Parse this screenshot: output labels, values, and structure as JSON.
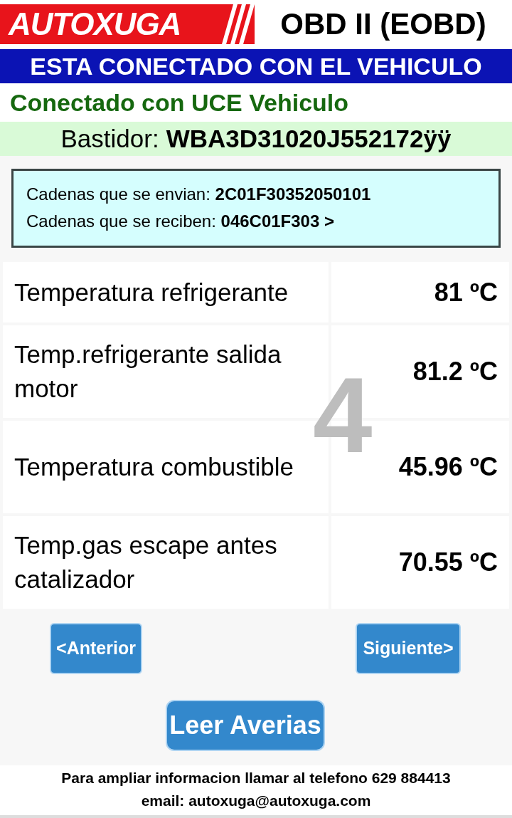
{
  "header": {
    "logo": "AUTOXUGA",
    "title": "OBD II (EOBD)"
  },
  "banner": "ESTA CONECTADO CON EL VEHICULO",
  "connection_status": "Conectado con UCE Vehiculo",
  "vin": {
    "label": "Bastidor:",
    "value": "WBA3D31020J552172ÿÿ"
  },
  "strings": [
    {
      "label": "Cadenas que se envian:",
      "value": "2C01F30352050101"
    },
    {
      "label": "Cadenas que se reciben:",
      "value": "046C01F303 >"
    }
  ],
  "page_number": "4",
  "readings": [
    {
      "name": "Temperatura refrigerante",
      "value": "81 ºC"
    },
    {
      "name": "Temp.refrigerante salida motor",
      "value": "81.2 ºC"
    },
    {
      "name": "Temperatura combustible",
      "value": "45.96 ºC"
    },
    {
      "name": "Temp.gas escape antes catalizador",
      "value": "70.55 ºC"
    }
  ],
  "nav_buttons": {
    "previous": "<Anterior",
    "next": "Siguiente>"
  },
  "action_button": "Leer Averias",
  "footer": [
    "Para ampliar informacion llamar al telefono 629 884413",
    "email: autoxuga@autoxuga.com"
  ]
}
